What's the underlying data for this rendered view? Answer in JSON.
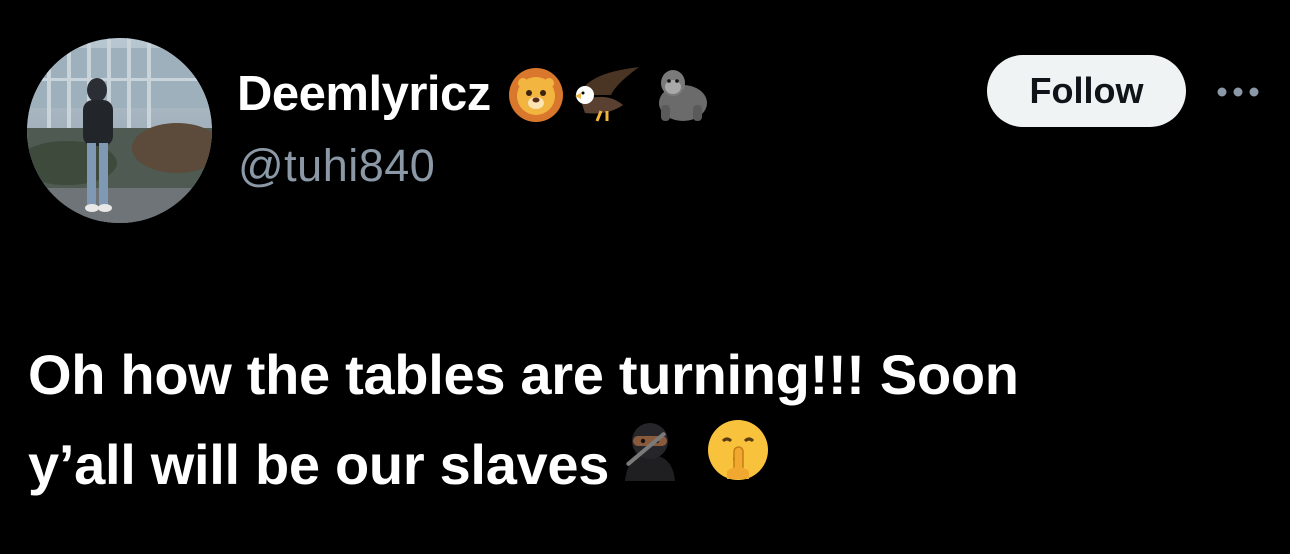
{
  "author": {
    "display_name": "Deemlyricz",
    "handle": "@tuhi840",
    "name_emojis": [
      "lion-face-icon",
      "eagle-icon",
      "gorilla-icon"
    ]
  },
  "actions": {
    "follow_label": "Follow",
    "more_icon": "more-dots-icon"
  },
  "tweet": {
    "line1": "Oh how the tables are turning!!! Soon",
    "line2": "y’all will be our slaves",
    "trailing_emojis": [
      "ninja-icon",
      "shushing-face-icon"
    ]
  },
  "colors": {
    "background": "#000000",
    "text_primary": "#ffffff",
    "text_secondary": "#8b98a5",
    "follow_bg": "#eff3f4",
    "follow_text": "#0f1419"
  }
}
